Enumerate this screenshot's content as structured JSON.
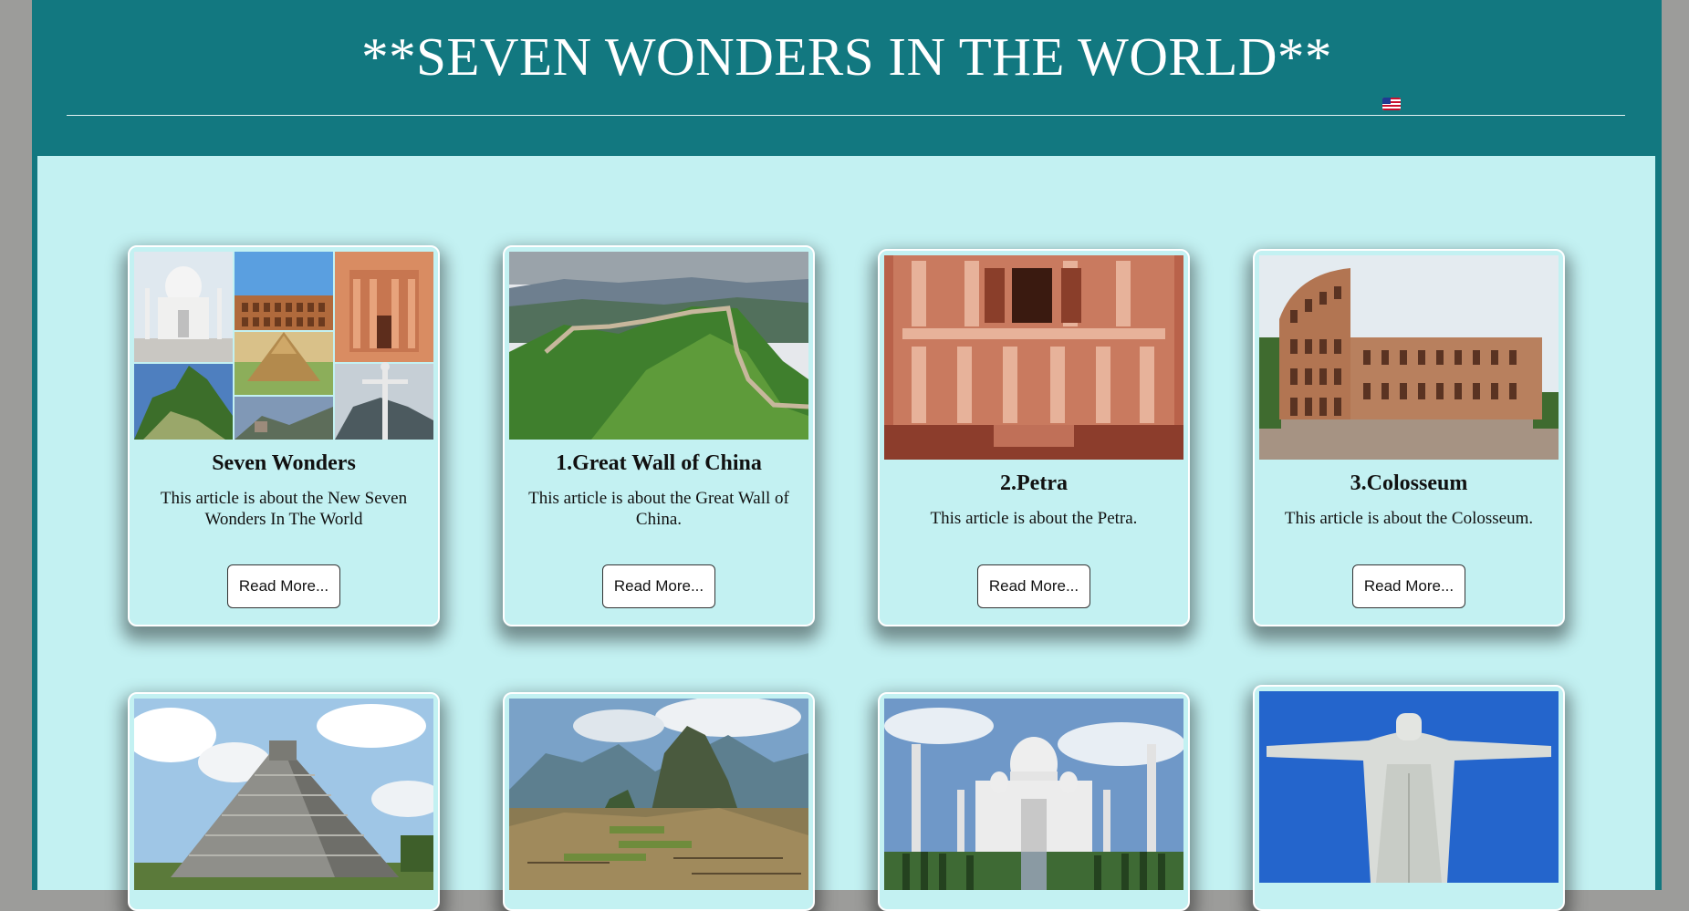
{
  "header": {
    "title": "**SEVEN WONDERS IN THE WORLD**",
    "flag_icon": "us-flag-icon"
  },
  "colors": {
    "header_bg": "#127880",
    "content_bg": "#c3f1f2",
    "outer_bg": "#9c9c9a"
  },
  "cards": [
    {
      "title": "Seven Wonders",
      "description": "This article is about the New Seven Wonders In The World",
      "button": "Read More...",
      "image": "seven-wonders-collage"
    },
    {
      "title": "1.Great Wall of China",
      "description": "This article is about the Great Wall of China.",
      "button": "Read More...",
      "image": "great-wall-of-china"
    },
    {
      "title": "2.Petra",
      "description": "This article is about the Petra.",
      "button": "Read More...",
      "image": "petra"
    },
    {
      "title": "3.Colosseum",
      "description": "This article is about the Colosseum.",
      "button": "Read More...",
      "image": "colosseum"
    },
    {
      "image": "chichen-itza"
    },
    {
      "image": "machu-picchu"
    },
    {
      "image": "taj-mahal"
    },
    {
      "image": "christ-the-redeemer"
    }
  ]
}
